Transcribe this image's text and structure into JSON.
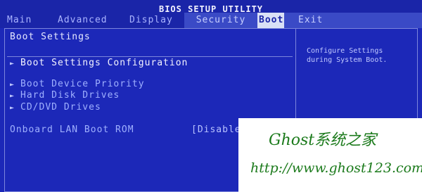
{
  "header": {
    "title": "BIOS SETUP UTILITY",
    "tabs": [
      {
        "label": "Main"
      },
      {
        "label": "Advanced"
      },
      {
        "label": "Display"
      },
      {
        "label": "Security"
      },
      {
        "label": "Boot"
      },
      {
        "label": "Exit"
      }
    ],
    "active_tab": "Boot"
  },
  "main": {
    "heading": "Boot Settings",
    "items": [
      {
        "label": "Boot Settings Configuration"
      },
      {
        "label": "Boot Device Priority"
      },
      {
        "label": "Hard Disk Drives"
      },
      {
        "label": "CD/DVD Drives"
      }
    ],
    "setting": {
      "label": "Onboard LAN Boot ROM",
      "value": "[Disabled]"
    }
  },
  "help": {
    "lines": [
      "Configure Settings",
      "during System Boot."
    ]
  },
  "watermark": {
    "line1": "Ghost系统之家",
    "line2": "http://www.ghost123.com"
  },
  "colors": {
    "background": "#1c28b8",
    "highlight": "#d9e0f6",
    "text": "#9fb0ff",
    "watermark": "#1b7a1b"
  }
}
